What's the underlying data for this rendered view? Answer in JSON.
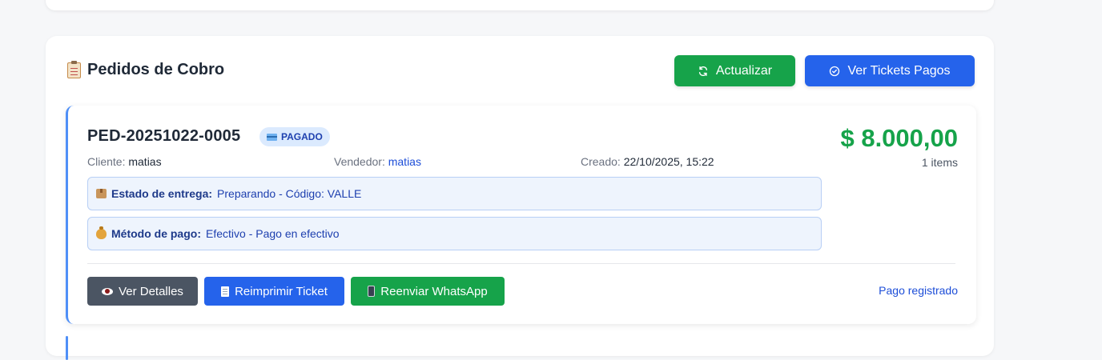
{
  "panel": {
    "title": "Pedidos de Cobro",
    "refresh_label": "Actualizar",
    "paid_tickets_label": "Ver Tickets Pagos"
  },
  "order": {
    "id": "PED-20251022-0005",
    "status": "PAGADO",
    "amount": "$ 8.000,00",
    "items": "1 items",
    "client_label": "Cliente:",
    "client": "matias",
    "seller_label": "Vendedor:",
    "seller": "matias",
    "created_label": "Creado:",
    "created": "22/10/2025, 15:22",
    "delivery_label": "Estado de entrega:",
    "delivery_value": "Preparando - Código: VALLE",
    "payment_label": "Método de pago:",
    "payment_value": "Efectivo - Pago en efectivo",
    "actions": {
      "details": "Ver Detalles",
      "reprint": "Reimprimir Ticket",
      "whatsapp": "Reenviar WhatsApp"
    },
    "paid_status": "Pago registrado"
  },
  "colors": {
    "accent_green": "#16a34a",
    "accent_blue": "#2563eb",
    "badge_bg": "#dbeafe"
  }
}
